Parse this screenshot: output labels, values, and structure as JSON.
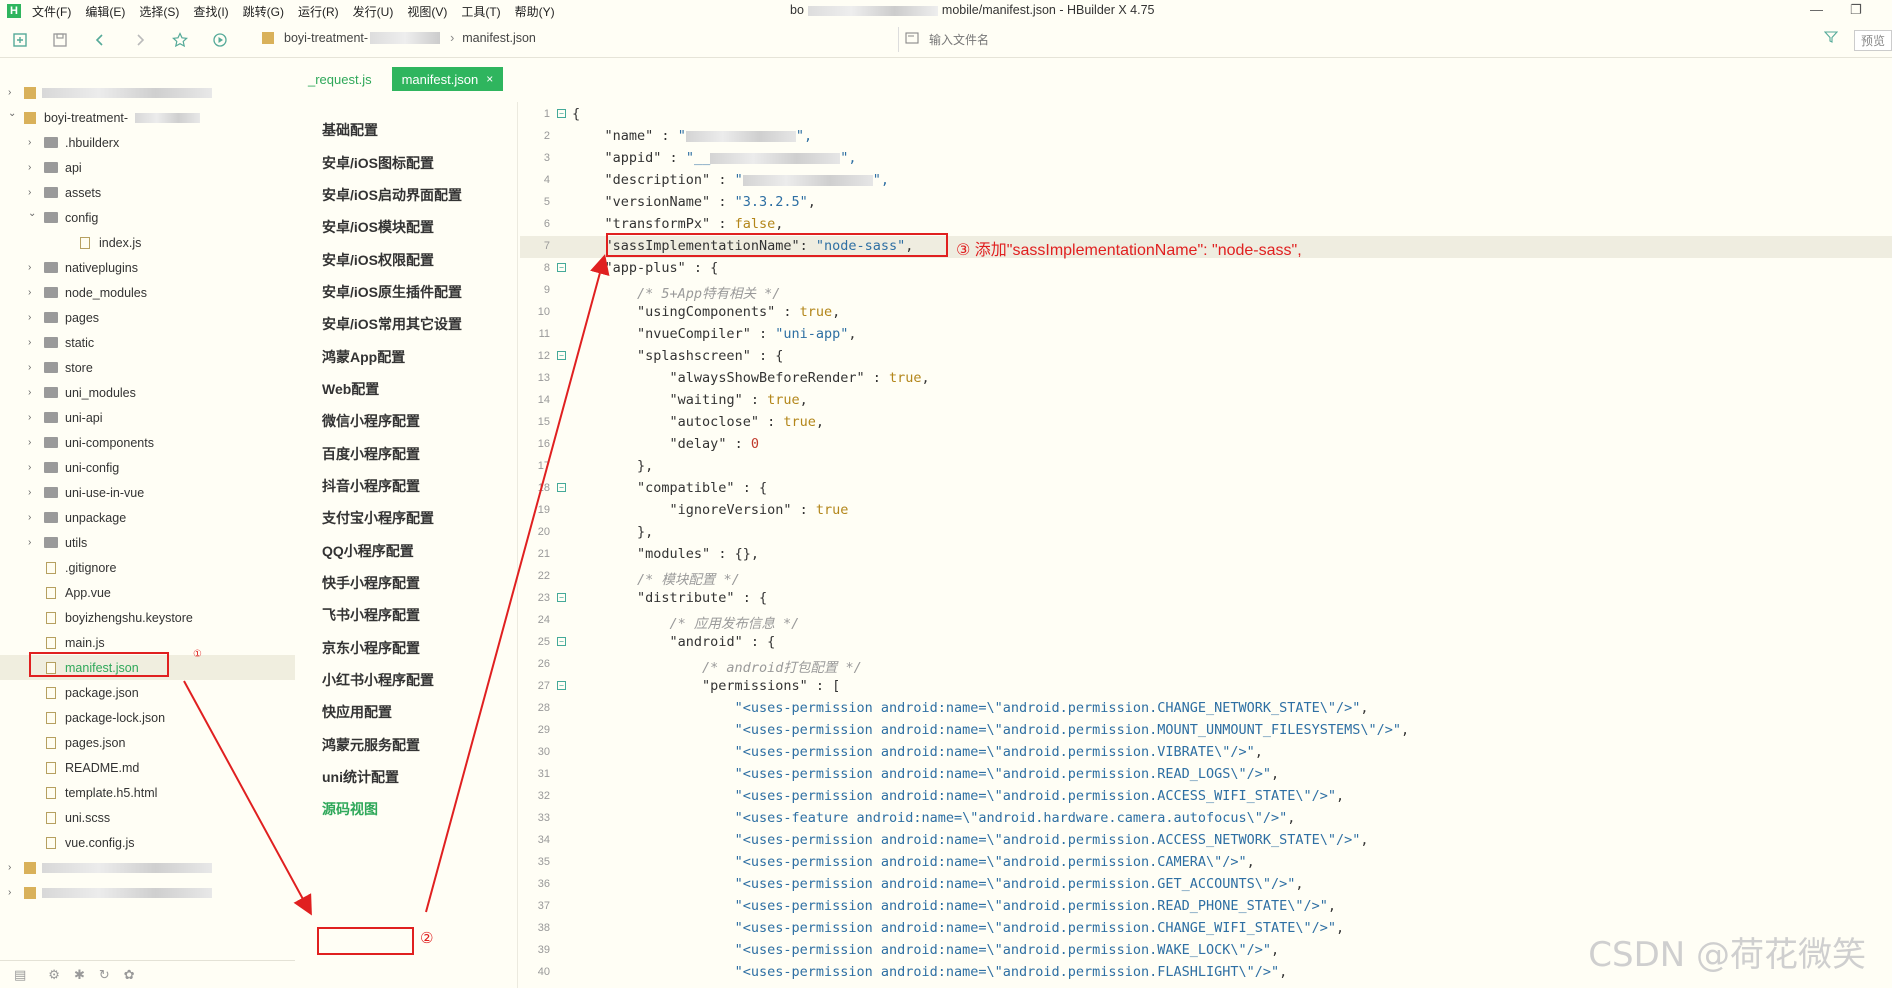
{
  "app": {
    "logo": "H",
    "title_prefix": "bo",
    "title_suffix": "mobile/manifest.json - HBuilder X 4.75",
    "minimize": "—",
    "restore": "❐"
  },
  "menu": [
    "文件(F)",
    "编辑(E)",
    "选择(S)",
    "查找(I)",
    "跳转(G)",
    "运行(R)",
    "发行(U)",
    "视图(V)",
    "工具(T)",
    "帮助(Y)"
  ],
  "toolbar": {
    "breadcrumb_project": "boyi-treatment-",
    "breadcrumb_sep": "›",
    "breadcrumb_file": "manifest.json",
    "search_placeholder": "输入文件名",
    "preview_label": "预览"
  },
  "tree": {
    "project_name": "boyi-treatment-",
    "items": [
      {
        "label": ".hbuilderx",
        "kind": "folder"
      },
      {
        "label": "api",
        "kind": "folder"
      },
      {
        "label": "assets",
        "kind": "folder"
      },
      {
        "label": "config",
        "kind": "folder"
      },
      {
        "label": "index.js",
        "kind": "file"
      },
      {
        "label": "nativeplugins",
        "kind": "folder"
      },
      {
        "label": "node_modules",
        "kind": "folder"
      },
      {
        "label": "pages",
        "kind": "folder"
      },
      {
        "label": "static",
        "kind": "folder"
      },
      {
        "label": "store",
        "kind": "folder"
      },
      {
        "label": "uni_modules",
        "kind": "folder"
      },
      {
        "label": "uni-api",
        "kind": "folder"
      },
      {
        "label": "uni-components",
        "kind": "folder"
      },
      {
        "label": "uni-config",
        "kind": "folder"
      },
      {
        "label": "uni-use-in-vue",
        "kind": "folder"
      },
      {
        "label": "unpackage",
        "kind": "folder"
      },
      {
        "label": "utils",
        "kind": "folder"
      },
      {
        "label": ".gitignore",
        "kind": "file"
      },
      {
        "label": "App.vue",
        "kind": "file"
      },
      {
        "label": "boyizhengshu.keystore",
        "kind": "file"
      },
      {
        "label": "main.js",
        "kind": "file"
      },
      {
        "label": "manifest.json",
        "kind": "file"
      },
      {
        "label": "package.json",
        "kind": "file"
      },
      {
        "label": "package-lock.json",
        "kind": "file"
      },
      {
        "label": "pages.json",
        "kind": "file"
      },
      {
        "label": "README.md",
        "kind": "file"
      },
      {
        "label": "template.h5.html",
        "kind": "file"
      },
      {
        "label": "uni.scss",
        "kind": "file"
      },
      {
        "label": "vue.config.js",
        "kind": "file"
      }
    ]
  },
  "tabs": [
    {
      "label": "_request.js",
      "active": false
    },
    {
      "label": "manifest.json",
      "active": true,
      "close": "×"
    }
  ],
  "config_nav": [
    "基础配置",
    "安卓/iOS图标配置",
    "安卓/iOS启动界面配置",
    "安卓/iOS模块配置",
    "安卓/iOS权限配置",
    "安卓/iOS原生插件配置",
    "安卓/iOS常用其它设置",
    "鸿蒙App配置",
    "Web配置",
    "微信小程序配置",
    "百度小程序配置",
    "抖音小程序配置",
    "支付宝小程序配置",
    "QQ小程序配置",
    "快手小程序配置",
    "飞书小程序配置",
    "京东小程序配置",
    "小红书小程序配置",
    "快应用配置",
    "鸿蒙元服务配置",
    "uni统计配置",
    "源码视图"
  ],
  "code": [
    "{",
    "    \"name\" : \"",
    "    \"appid\" : \"__",
    "    \"description\" : \"",
    "    \"versionName\" : \"3.3.2.5\",",
    "    \"transformPx\" : false,",
    "    \"sassImplementationName\": \"node-sass\",",
    "    \"app-plus\" : {",
    "        /* 5+App特有相关 */",
    "        \"usingComponents\" : true,",
    "        \"nvueCompiler\" : \"uni-app\",",
    "        \"splashscreen\" : {",
    "            \"alwaysShowBeforeRender\" : true,",
    "            \"waiting\" : true,",
    "            \"autoclose\" : true,",
    "            \"delay\" : 0",
    "        },",
    "        \"compatible\" : {",
    "            \"ignoreVersion\" : true",
    "        },",
    "        \"modules\" : {},",
    "        /* 模块配置 */",
    "        \"distribute\" : {",
    "            /* 应用发布信息 */",
    "            \"android\" : {",
    "                /* android打包配置 */",
    "                \"permissions\" : [",
    "                    \"<uses-permission android:name=\\\"android.permission.CHANGE_NETWORK_STATE\\\"/>\",",
    "                    \"<uses-permission android:name=\\\"android.permission.MOUNT_UNMOUNT_FILESYSTEMS\\\"/>\",",
    "                    \"<uses-permission android:name=\\\"android.permission.VIBRATE\\\"/>\",",
    "                    \"<uses-permission android:name=\\\"android.permission.READ_LOGS\\\"/>\",",
    "                    \"<uses-permission android:name=\\\"android.permission.ACCESS_WIFI_STATE\\\"/>\",",
    "                    \"<uses-feature android:name=\\\"android.hardware.camera.autofocus\\\"/>\",",
    "                    \"<uses-permission android:name=\\\"android.permission.ACCESS_NETWORK_STATE\\\"/>\",",
    "                    \"<uses-permission android:name=\\\"android.permission.CAMERA\\\"/>\",",
    "                    \"<uses-permission android:name=\\\"android.permission.GET_ACCOUNTS\\\"/>\",",
    "                    \"<uses-permission android:name=\\\"android.permission.READ_PHONE_STATE\\\"/>\",",
    "                    \"<uses-permission android:name=\\\"android.permission.CHANGE_WIFI_STATE\\\"/>\",",
    "                    \"<uses-permission android:name=\\\"android.permission.WAKE_LOCK\\\"/>\",",
    "                    \"<uses-permission android:name=\\\"android.permission.FLASHLIGHT\\\"/>\","
  ],
  "annotations": {
    "step1": "①",
    "step2": "②",
    "step3": "③ 添加\"sassImplementationName\": \"node-sass\","
  },
  "watermark": "CSDN @荷花微笑",
  "colors": {
    "accent": "#2fb55e",
    "annotation": "#e02020",
    "background": "#fffef5"
  }
}
